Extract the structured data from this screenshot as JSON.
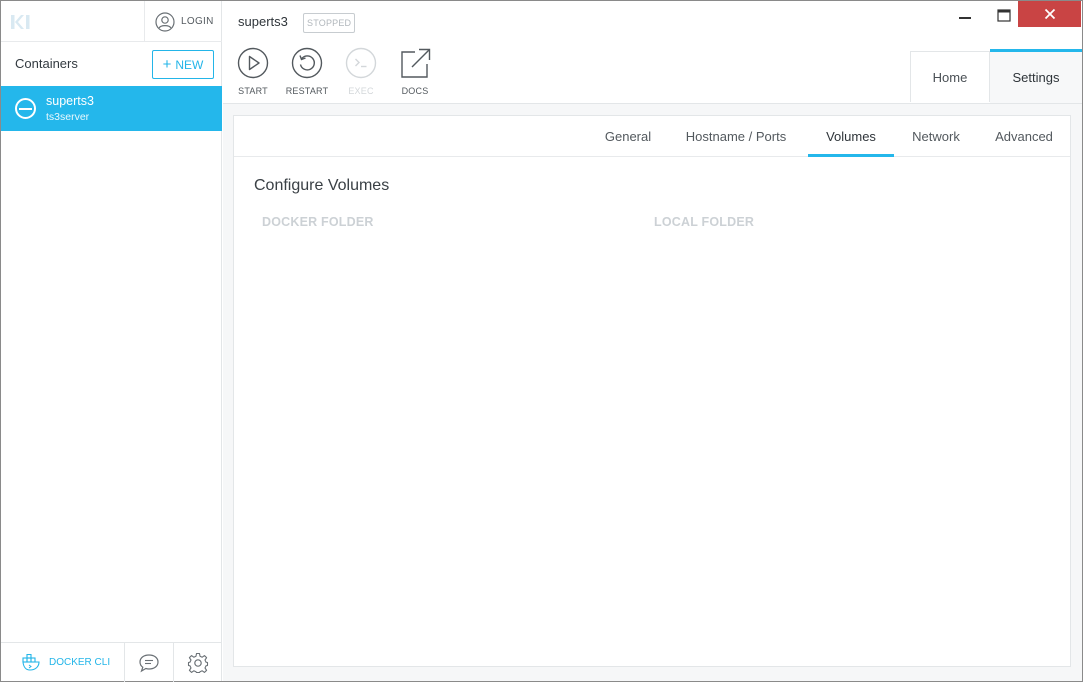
{
  "sidebar": {
    "login_label": "LOGIN",
    "containers_title": "Containers",
    "new_button": {
      "icon": "plus-icon",
      "label": "NEW"
    },
    "containers": [
      {
        "name": "superts3",
        "image": "ts3server",
        "status_icon": "stopped-icon"
      }
    ],
    "bottom": {
      "docker_cli_label": "DOCKER CLI",
      "chat_icon": "chat-bubble-icon",
      "settings_icon": "gear-icon"
    }
  },
  "header": {
    "container_name": "superts3",
    "status": "STOPPED",
    "actions": [
      {
        "label": "START",
        "icon": "play-icon",
        "enabled": true
      },
      {
        "label": "RESTART",
        "icon": "restart-icon",
        "enabled": true
      },
      {
        "label": "EXEC",
        "icon": "terminal-icon",
        "enabled": false
      },
      {
        "label": "DOCS",
        "icon": "external-link-icon",
        "enabled": true
      }
    ],
    "tabs": [
      {
        "label": "Home",
        "active": false
      },
      {
        "label": "Settings",
        "active": true
      }
    ]
  },
  "settings": {
    "subtabs": [
      {
        "label": "General",
        "active": false
      },
      {
        "label": "Hostname / Ports",
        "active": false
      },
      {
        "label": "Volumes",
        "active": true
      },
      {
        "label": "Network",
        "active": false
      },
      {
        "label": "Advanced",
        "active": false
      }
    ],
    "section_title": "Configure Volumes",
    "columns": [
      "DOCKER FOLDER",
      "LOCAL FOLDER"
    ]
  },
  "colors": {
    "accent": "#24b7eb",
    "close_button": "#c94444"
  }
}
